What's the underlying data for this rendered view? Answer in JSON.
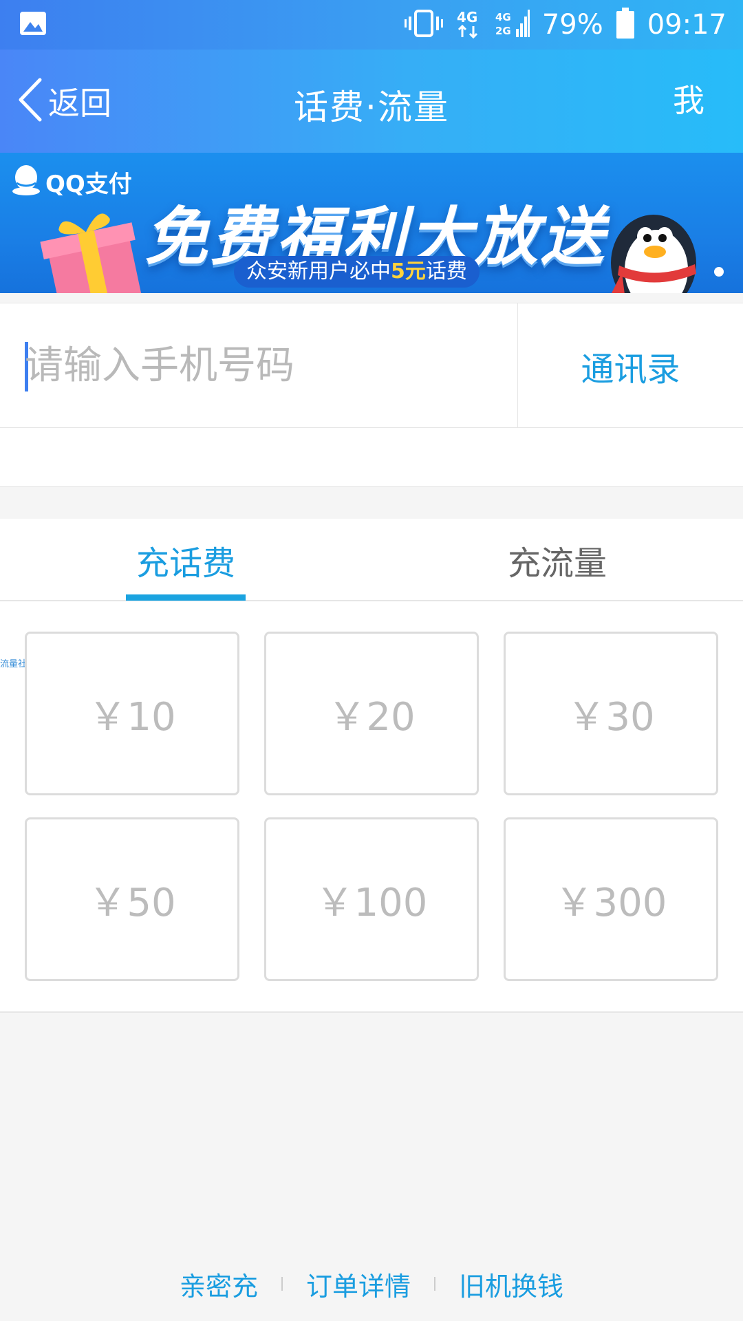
{
  "status_bar": {
    "battery": "79%",
    "time": "09:17",
    "icons": [
      "image-icon",
      "vibrate-icon",
      "signal-4g-icon",
      "signal-4g-2g-icon",
      "battery-icon"
    ]
  },
  "header": {
    "back_label": "返回",
    "title": "话费·流量",
    "me_label": "我"
  },
  "banner": {
    "brand": "QQ支付",
    "headline": "免费福利大放送",
    "sub_prefix": "众安新用户必中",
    "sub_highlight": "5元",
    "sub_suffix": "话费"
  },
  "phone": {
    "placeholder": "请输入手机号码",
    "value": "",
    "contacts_label": "通讯录"
  },
  "tabs": {
    "left": "充话费",
    "right": "充流量",
    "active": "left"
  },
  "watermark": "流量社区",
  "amounts": [
    "￥10",
    "￥20",
    "￥30",
    "￥50",
    "￥100",
    "￥300"
  ],
  "footer": {
    "link1": "亲密充",
    "link2": "订单详情",
    "link3": "旧机换钱"
  },
  "colors": {
    "accent": "#1a9de0",
    "header_gradient_start": "#4a86f7",
    "header_gradient_end": "#27bcf9"
  }
}
